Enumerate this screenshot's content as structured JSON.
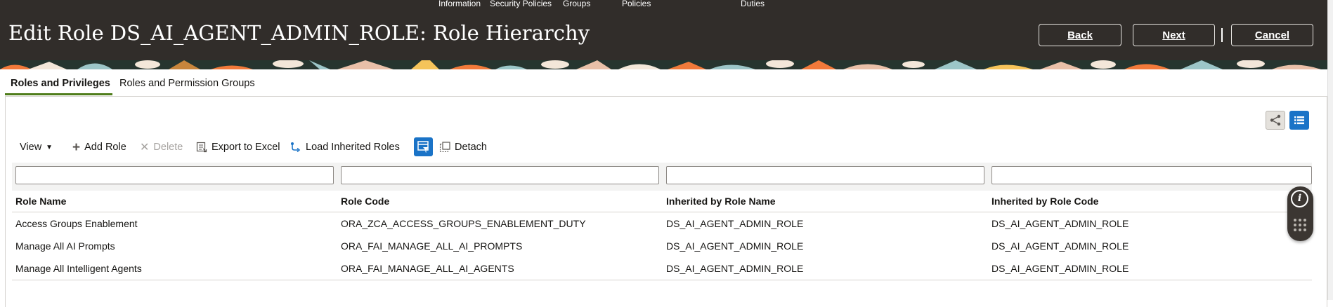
{
  "train": [
    "Information",
    "Security Policies",
    "Groups",
    "Policies",
    "Duties"
  ],
  "header": {
    "title": "Edit Role DS_AI_AGENT_ADMIN_ROLE: Role Hierarchy",
    "back_label": "Back",
    "next_label": "Next",
    "cancel_label": "Cancel"
  },
  "tabs": [
    {
      "label": "Roles and Privileges",
      "active": true
    },
    {
      "label": "Roles and Permission Groups",
      "active": false
    }
  ],
  "view_toggle": {
    "hierarchy_icon": "hierarchy-view-icon",
    "list_icon": "list-view-icon",
    "selected": "list"
  },
  "toolbar": {
    "view_label": "View",
    "add_role_label": "Add Role",
    "delete_label": "Delete",
    "export_label": "Export to Excel",
    "load_inherited_label": "Load Inherited Roles",
    "detach_label": "Detach"
  },
  "filters": [
    "",
    "",
    "",
    ""
  ],
  "table": {
    "columns": [
      "Role Name",
      "Role Code",
      "Inherited by Role Name",
      "Inherited by Role Code"
    ],
    "rows": [
      [
        "Access Groups Enablement",
        "ORA_ZCA_ACCESS_GROUPS_ENABLEMENT_DUTY",
        "DS_AI_AGENT_ADMIN_ROLE",
        "DS_AI_AGENT_ADMIN_ROLE"
      ],
      [
        "Manage All AI Prompts",
        "ORA_FAI_MANAGE_ALL_AI_PROMPTS",
        "DS_AI_AGENT_ADMIN_ROLE",
        "DS_AI_AGENT_ADMIN_ROLE"
      ],
      [
        "Manage All Intelligent Agents",
        "ORA_FAI_MANAGE_ALL_AI_AGENTS",
        "DS_AI_AGENT_ADMIN_ROLE",
        "DS_AI_AGENT_ADMIN_ROLE"
      ]
    ]
  },
  "colors": {
    "header_bg": "#312d2a",
    "accent_blue": "#1a73c7",
    "tab_underline": "#4f7d1b"
  }
}
